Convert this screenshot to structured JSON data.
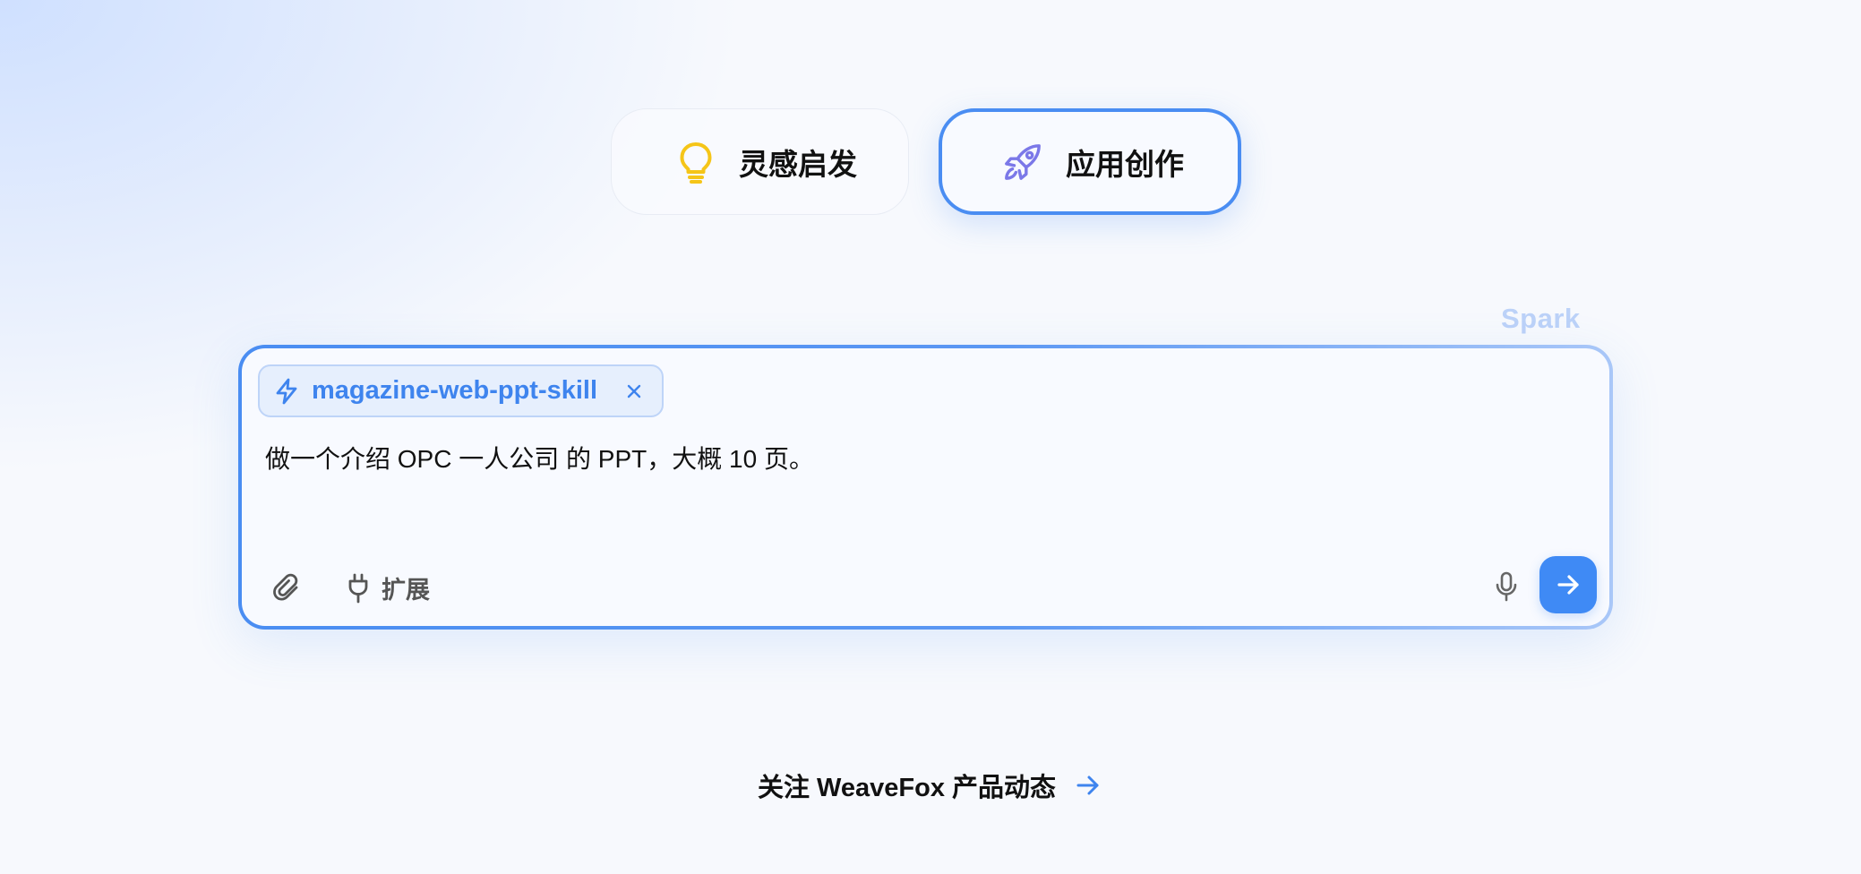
{
  "modes": {
    "inspiration_label": "灵感启发",
    "creation_label": "应用创作",
    "active": "应用创作"
  },
  "brand": {
    "spark_label": "Spark"
  },
  "composer": {
    "skill_chip_label": "magazine-web-ppt-skill",
    "prompt_value": "做一个介绍  OPC 一人公司 的 PPT，大概 10 页。",
    "extension_label": "扩展"
  },
  "footer": {
    "follow_label": "关注 WeaveFox 产品动态"
  },
  "icons": {
    "inspiration": "lightbulb-icon",
    "creation": "rocket-icon",
    "skill": "lightning-icon",
    "chip_close": "close-icon",
    "attach": "paperclip-icon",
    "extension": "plug-icon",
    "mic": "microphone-icon",
    "send": "arrow-right-icon",
    "follow": "arrow-right-icon"
  },
  "colors": {
    "accent": "#4a8df2",
    "send_button": "#3f8af5",
    "lightbulb": "#f5c518",
    "rocket": "#7b78e8",
    "spark": "#bcd2f8"
  }
}
